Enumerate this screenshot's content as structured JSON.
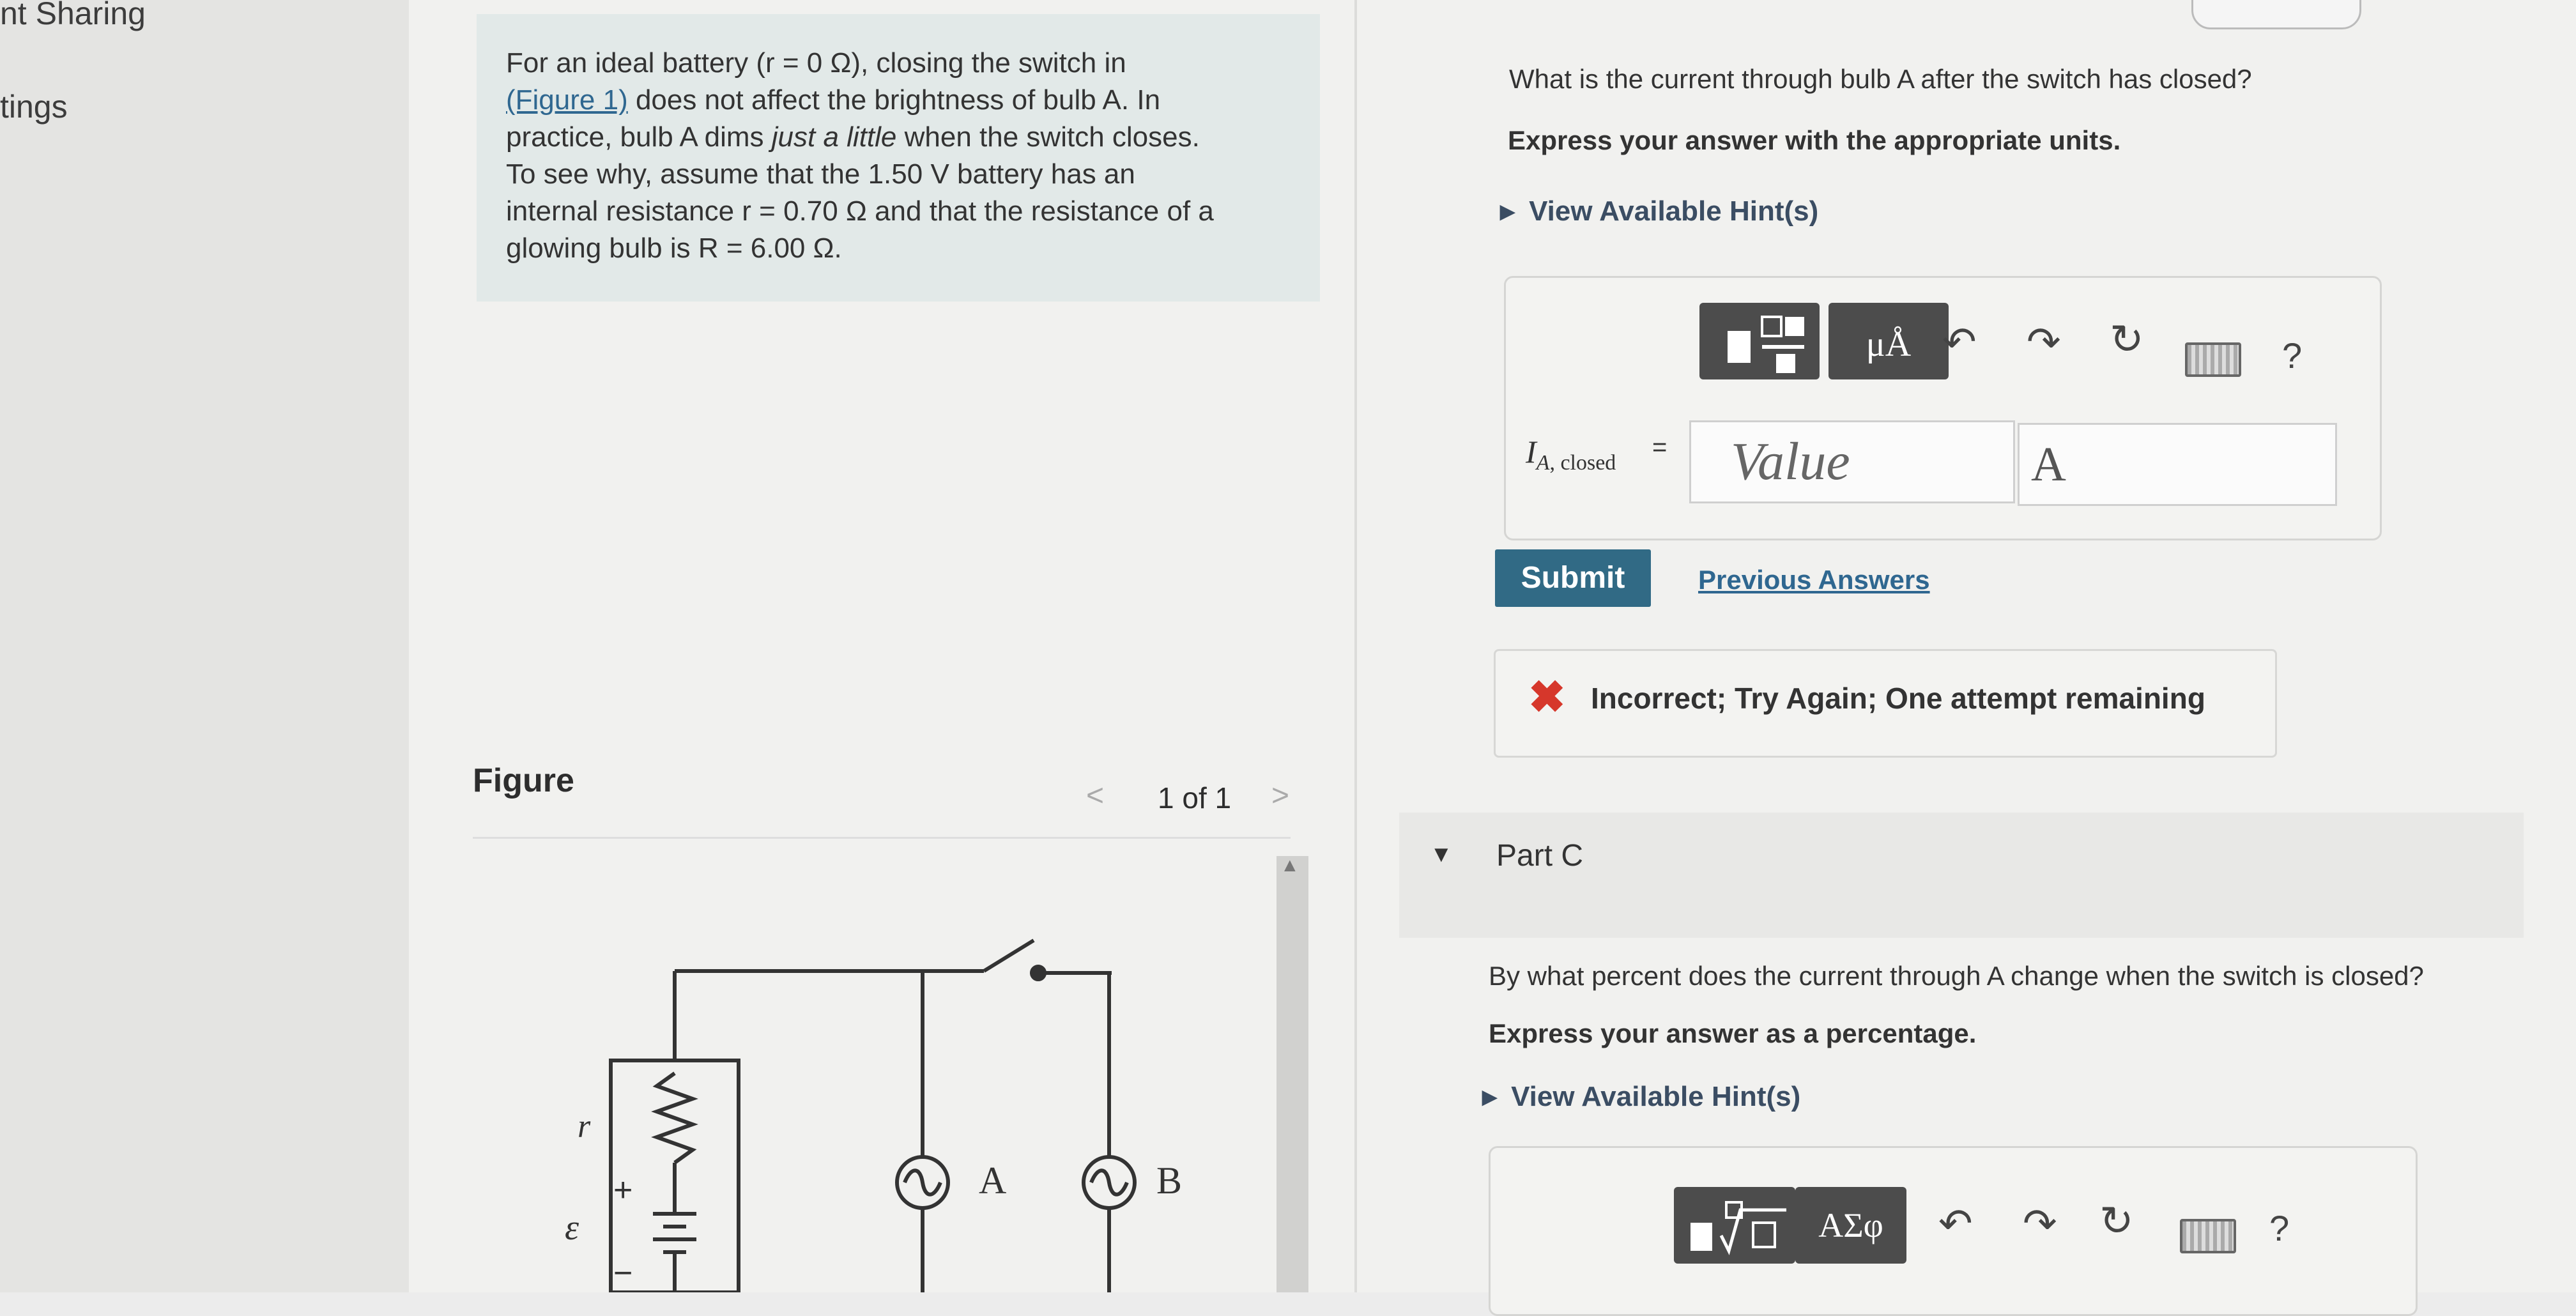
{
  "left_rail": {
    "item1": "nt Sharing",
    "item2": "tings"
  },
  "problem": {
    "line1": "For an ideal battery (r = 0 Ω), closing the switch in",
    "line2_link": "(Figure 1)",
    "line2_rest": " does not affect the brightness of bulb A. In",
    "line3_a": "practice, bulb A dims ",
    "line3_em": "just a little",
    "line3_b": " when the switch closes.",
    "line4": "To see why, assume that the 1.50 V battery has an",
    "line5": "internal resistance r = 0.70 Ω and that the resistance of a",
    "line6": "glowing bulb is R = 6.00 Ω."
  },
  "figure": {
    "title": "Figure",
    "counter": "1 of 1",
    "prev_glyph": "<",
    "next_glyph": ">",
    "labels": {
      "r": "r",
      "emf": "ε",
      "plus": "+",
      "minus": "−",
      "bulb_a": "A",
      "bulb_b": "B"
    }
  },
  "part_b": {
    "question": "What is the current through bulb A after the switch has closed?",
    "instruction": "Express your answer with the appropriate units.",
    "hint_label": "View Available Hint(s)",
    "answer_label_main": "I",
    "answer_label_sub": "A, closed",
    "equals": "=",
    "value_placeholder": "Value",
    "unit_value": "A",
    "toolbar": {
      "units_btn": "μÅ",
      "help": "?"
    },
    "submit_label": "Submit",
    "previous_answers_label": "Previous Answers",
    "feedback": "Incorrect; Try Again; One attempt remaining"
  },
  "part_c": {
    "title": "Part C",
    "question": "By what percent does the current through A change when the switch is closed?",
    "instruction": "Express your answer as a percentage.",
    "hint_label": "View Available Hint(s)",
    "toolbar": {
      "greek_btn": "ΑΣφ",
      "help": "?"
    }
  },
  "colors": {
    "accent_button": "#316a85",
    "link": "#2f6790",
    "error": "#d6372b",
    "problem_bg": "#e2e9e8"
  }
}
